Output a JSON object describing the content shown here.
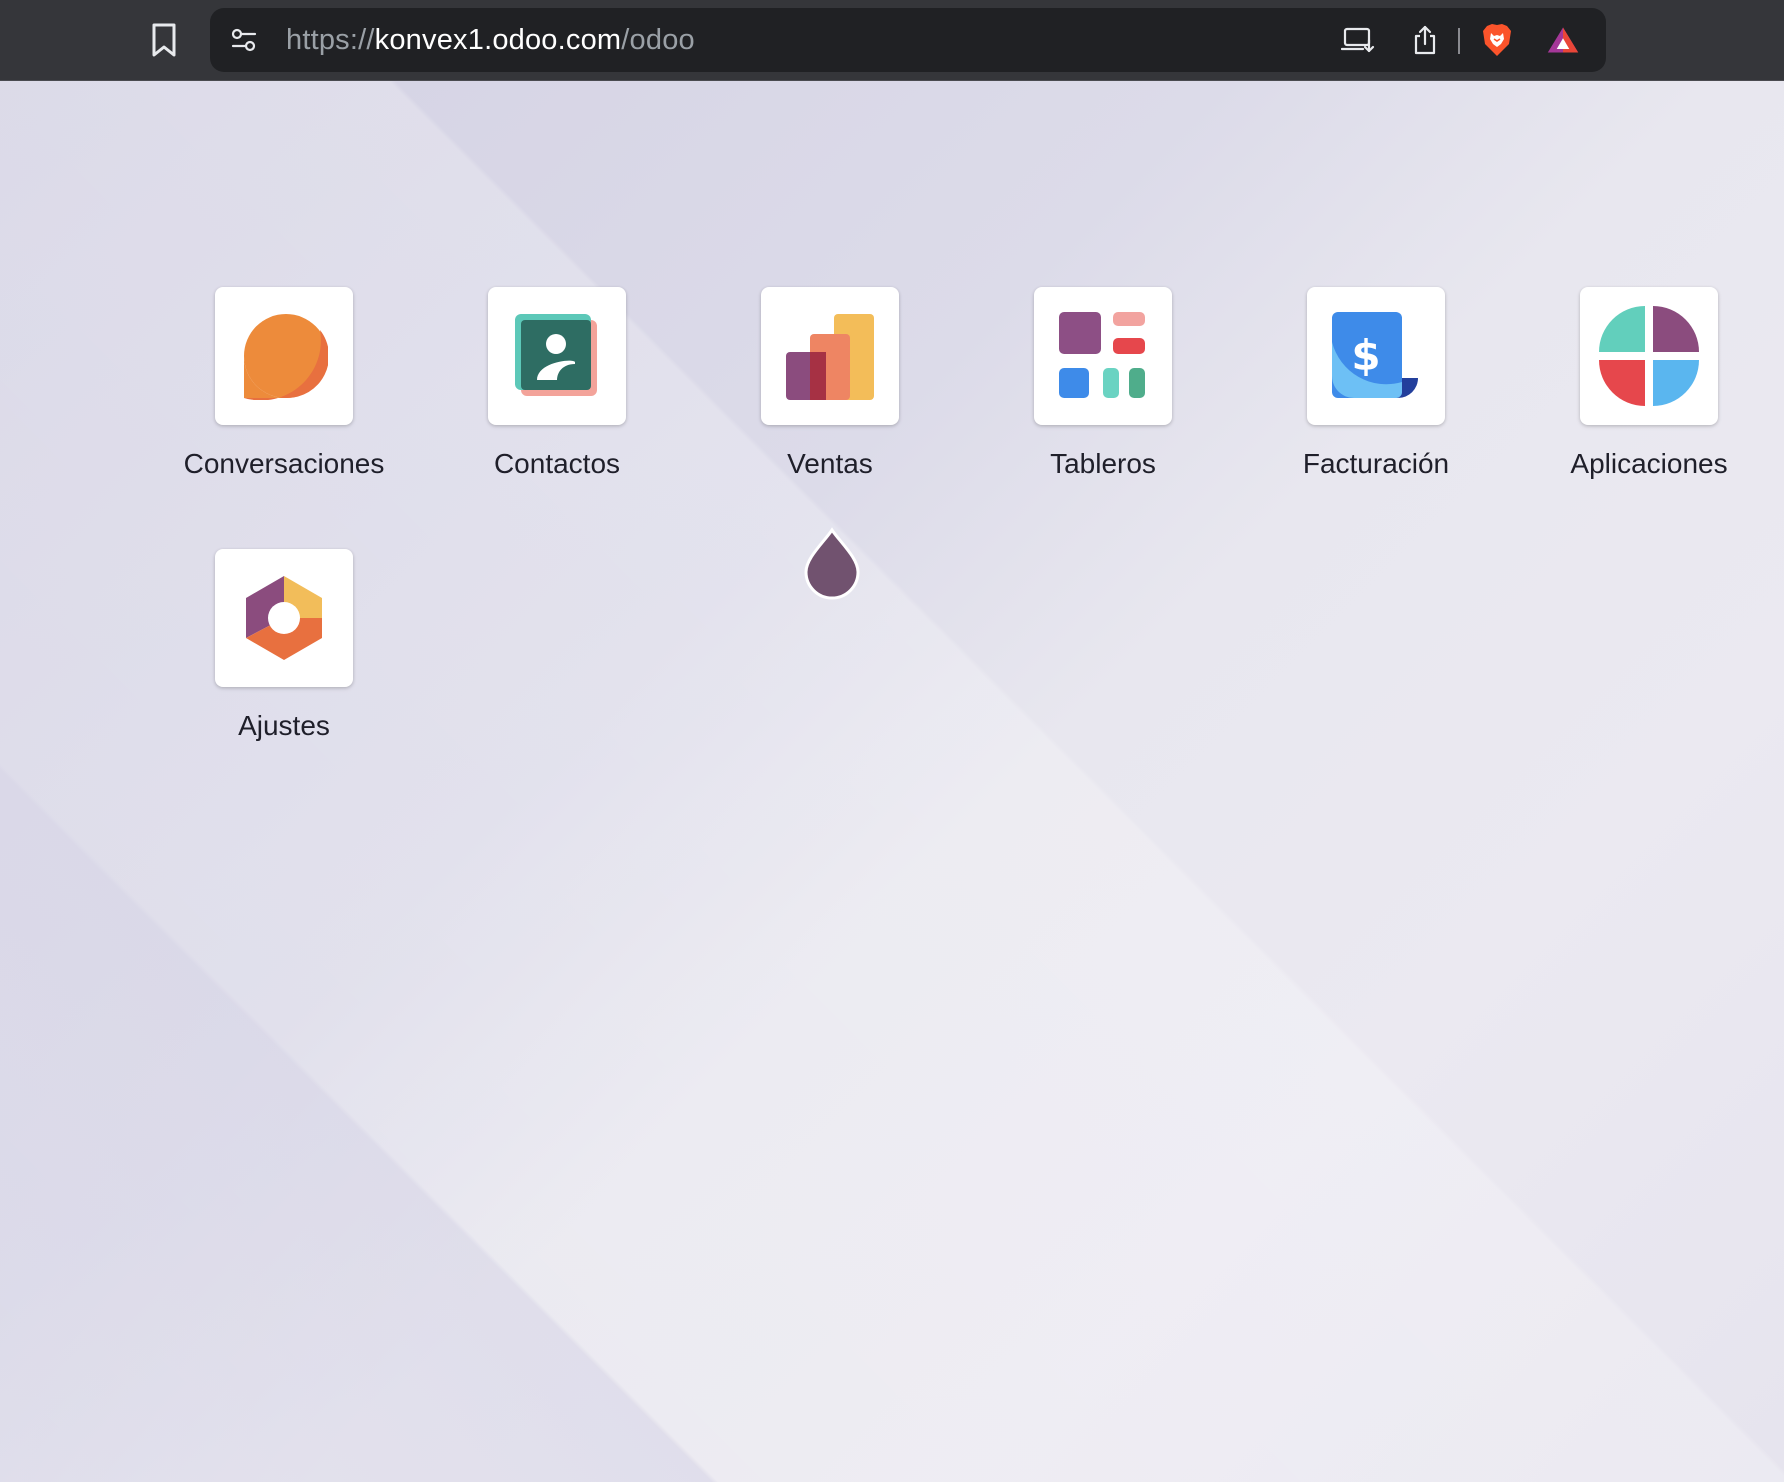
{
  "browser": {
    "url": {
      "scheme": "https://",
      "host": "konvex1.odoo.com",
      "path": "/odoo"
    },
    "icons": [
      "bookmark-icon",
      "tune-icon",
      "install-app-icon",
      "share-icon",
      "brave-shield-icon",
      "brave-rewards-icon"
    ]
  },
  "apps": [
    {
      "label": "Conversaciones",
      "icon": "conversaciones-icon"
    },
    {
      "label": "Contactos",
      "icon": "contactos-icon"
    },
    {
      "label": "Ventas",
      "icon": "ventas-icon"
    },
    {
      "label": "Tableros",
      "icon": "tableros-icon"
    },
    {
      "label": "Facturación",
      "icon": "facturacion-icon"
    },
    {
      "label": "Aplicaciones",
      "icon": "aplicaciones-icon"
    },
    {
      "label": "Ajustes",
      "icon": "ajustes-icon"
    }
  ],
  "colors": {
    "topbar": "#35363a",
    "urlbar": "#202124",
    "odoo_purple": "#71526f",
    "orange": "#ed8b3b"
  }
}
